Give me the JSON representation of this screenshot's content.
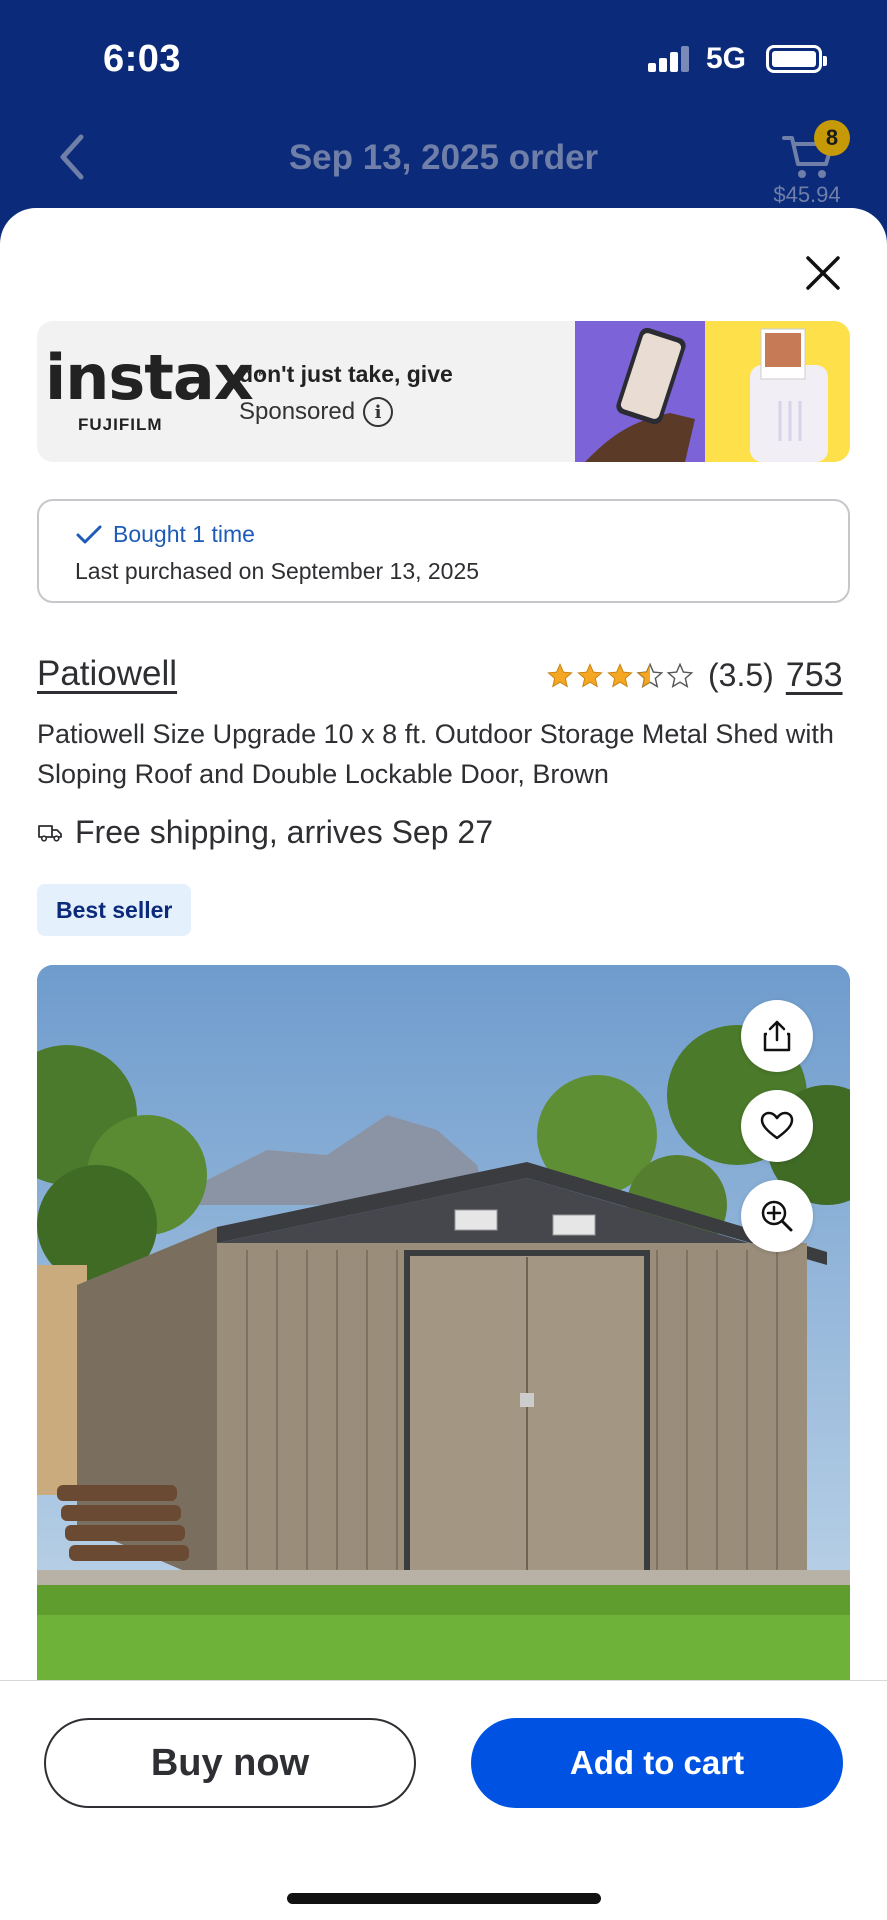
{
  "status_bar": {
    "time": "6:03",
    "network": "5G"
  },
  "header": {
    "title": "Sep 13, 2025 order",
    "cart_count": "8",
    "cart_total": "$45.94"
  },
  "ad": {
    "brand": "instax",
    "trademark": "™",
    "sub_brand": "FUJIFILM",
    "headline": "don't just take, give",
    "sponsored_label": "Sponsored"
  },
  "purchase_history": {
    "bought_label": "Bought 1 time",
    "last_purchased": "Last purchased on September 13, 2025"
  },
  "product": {
    "brand": "Patiowell",
    "rating_value": "(3.5)",
    "rating_stars": 3.5,
    "review_count": "753",
    "title": "Patiowell Size Upgrade 10 x 8 ft. Outdoor Storage Metal Shed with Sloping Roof and Double Lockable Door, Brown",
    "shipping": "Free shipping, arrives Sep 27",
    "badge": "Best seller"
  },
  "actions": {
    "buy_now": "Buy now",
    "add_to_cart": "Add to cart"
  },
  "colors": {
    "header_bg": "#0b2a7a",
    "primary_blue": "#0053e2",
    "star": "#f5a623",
    "badge_bg": "#e5f0fd"
  }
}
